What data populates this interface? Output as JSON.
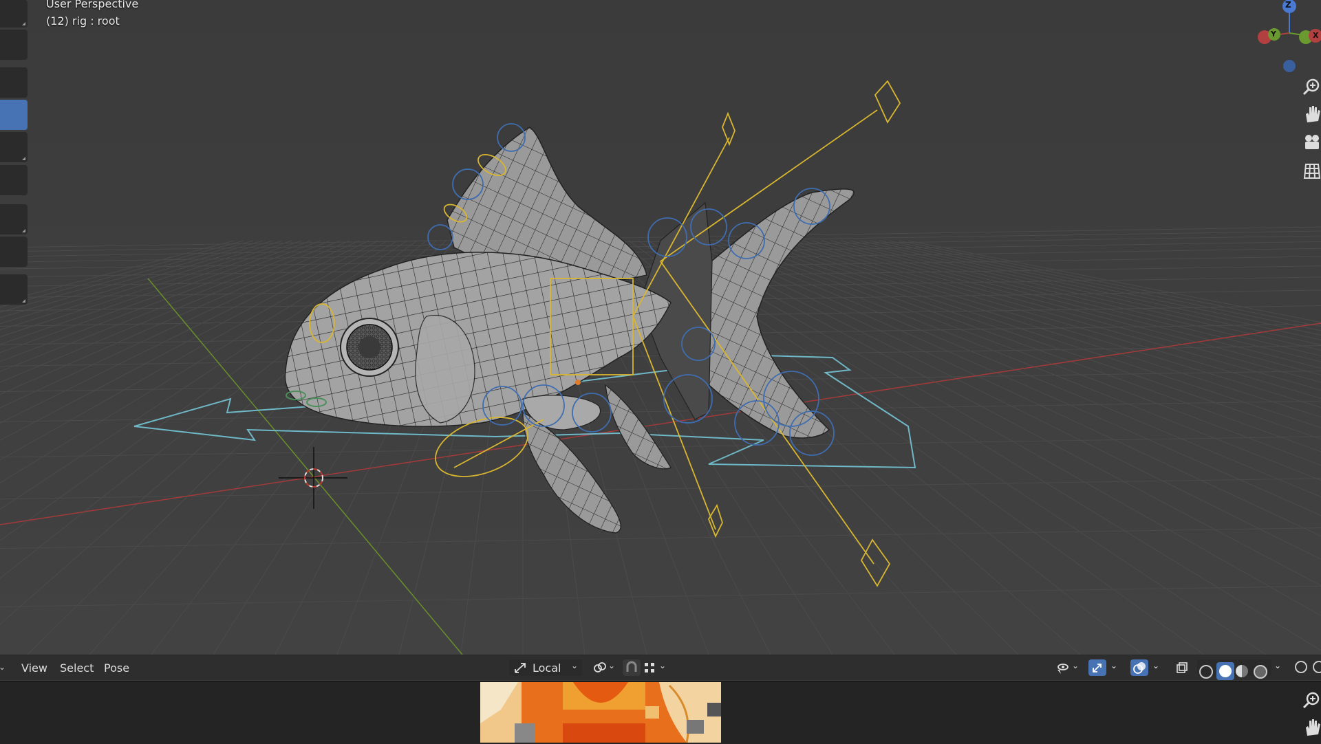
{
  "viewport": {
    "title": "User Perspective",
    "subtitle": "(12) rig : root",
    "gizmo": {
      "z": "Z",
      "y": "Y",
      "x": "X"
    }
  },
  "header": {
    "menus": [
      "View",
      "Select",
      "Pose"
    ],
    "transform_orientation": "Local",
    "icons": [
      "orientation-icon",
      "pivot-icon",
      "snap-icon",
      "snap-grid-icon",
      "visibility-icon",
      "gizmo-icon",
      "overlay-icon",
      "xray-icon",
      "wireframe-shading-icon",
      "solid-shading-icon",
      "material-shading-icon",
      "rendered-shading-icon"
    ]
  },
  "colors": {
    "viewport_bg": "#3d3d3d",
    "grid": "#4a4a4a",
    "x_axis": "#a33a3a",
    "y_axis": "#6a8f2a",
    "bone_yellow": "#d9b630",
    "bone_blue": "#3f6db0",
    "bone_cyan": "#6fb8c8",
    "accent": "#4772b3",
    "mesh": "#9c9c9c"
  }
}
